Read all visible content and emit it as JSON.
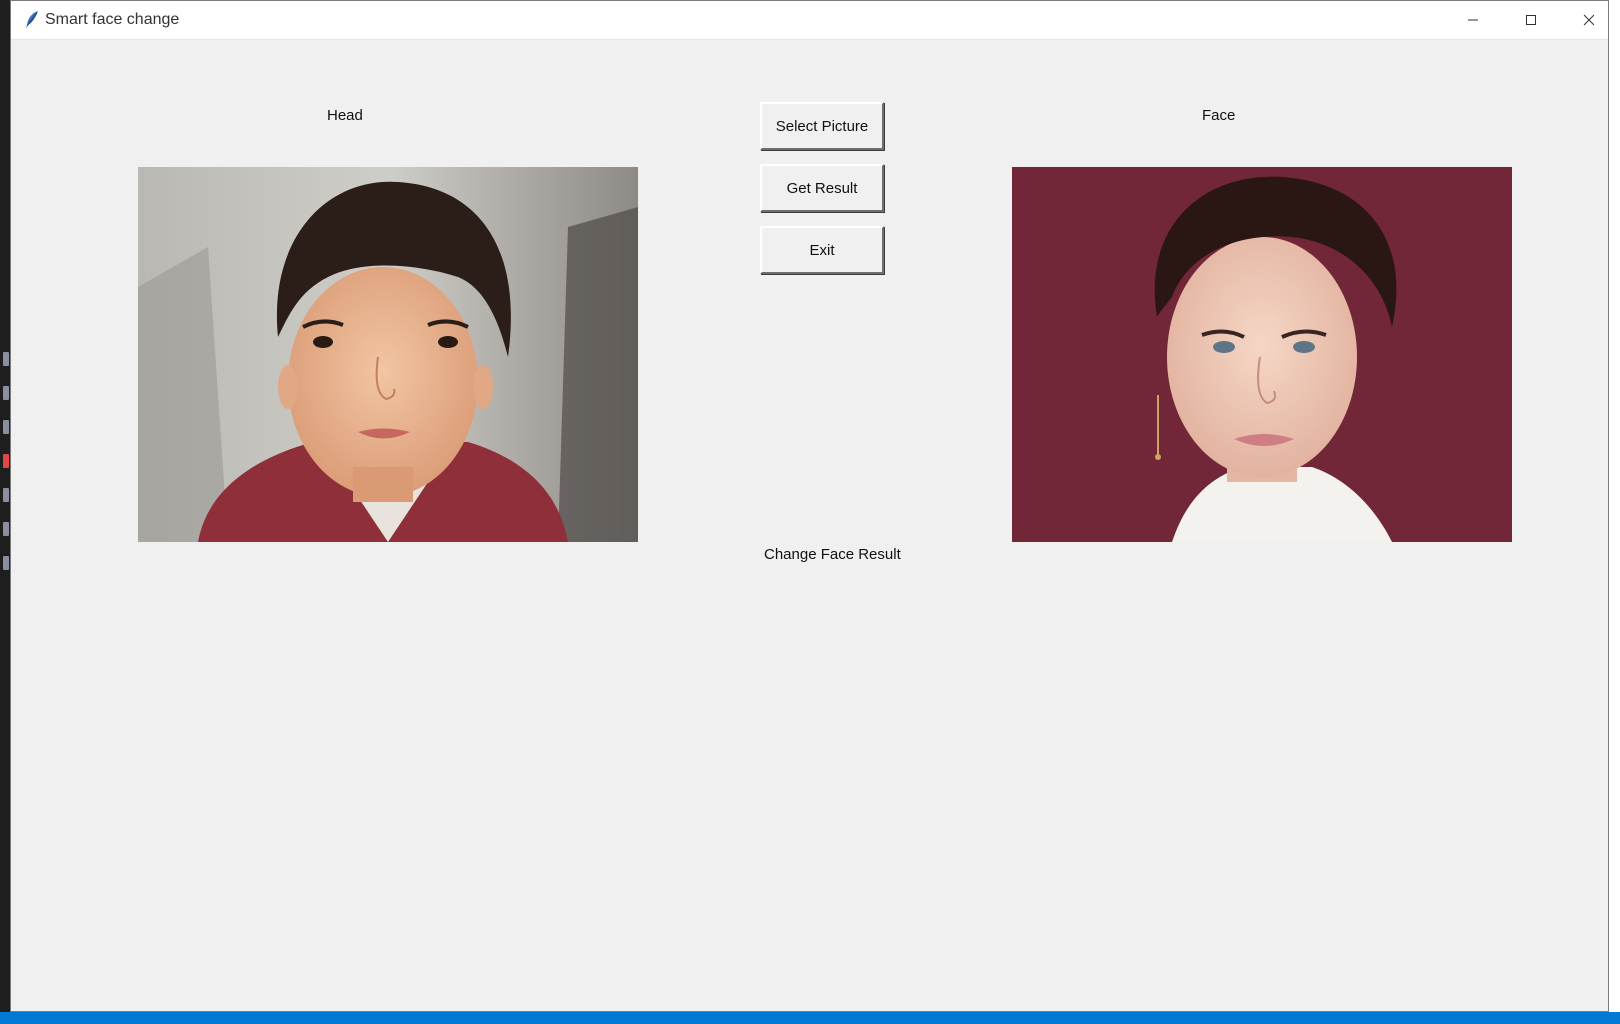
{
  "window": {
    "title": "Smart face change",
    "controls": {
      "minimize": "─",
      "maximize": "☐",
      "close": "✕"
    }
  },
  "labels": {
    "head": "Head",
    "face": "Face",
    "result": "Change Face Result"
  },
  "buttons": {
    "select_picture": "Select Picture",
    "get_result": "Get Result",
    "exit": "Exit"
  },
  "images": {
    "head": {
      "icon": "child-portrait-image"
    },
    "face": {
      "icon": "woman-portrait-image"
    }
  },
  "colors": {
    "window_bg": "#f0f0f0",
    "statusbar": "#0078d4",
    "face_bg": "#7a2a3d"
  }
}
